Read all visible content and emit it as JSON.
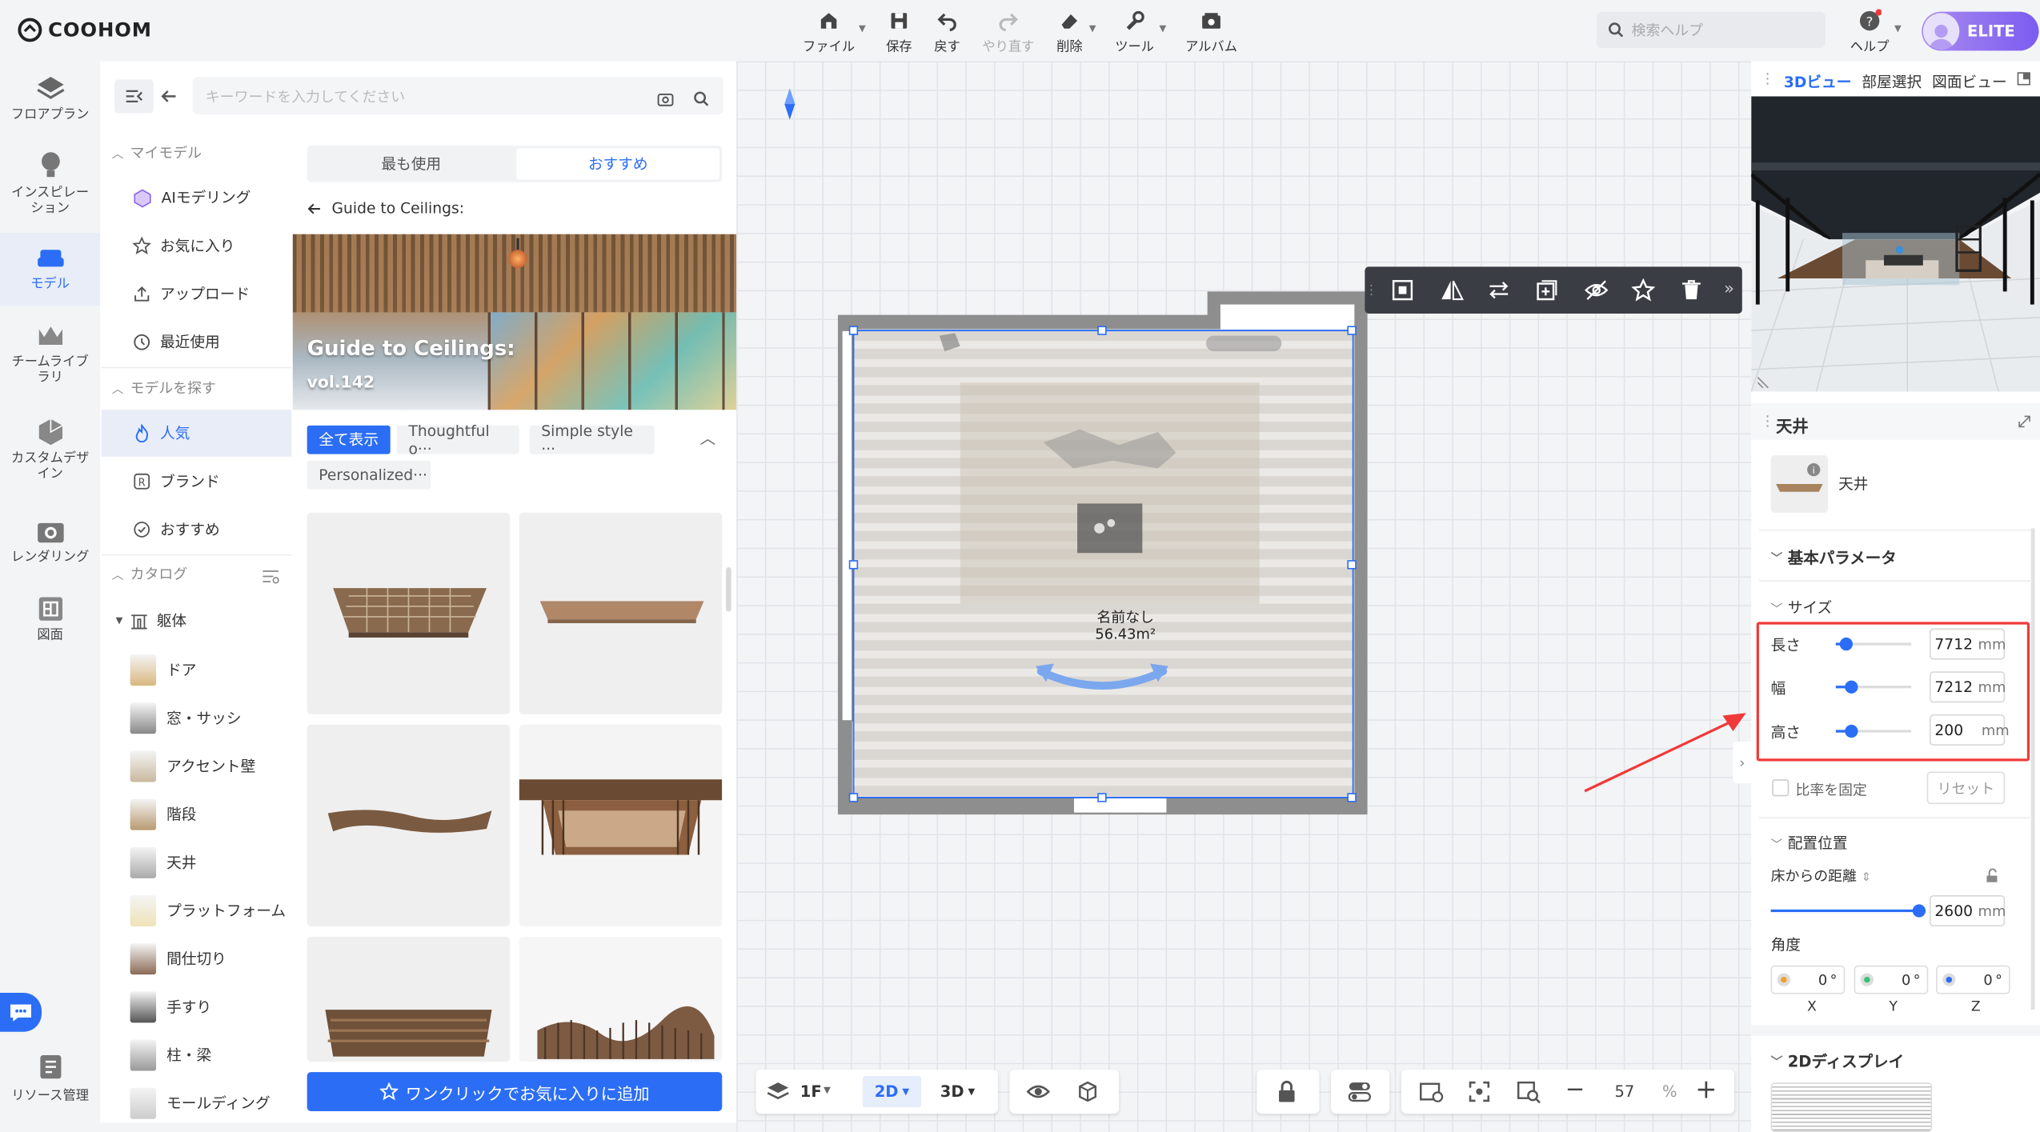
{
  "app": {
    "logo_text": "COOHOM"
  },
  "toolbar": {
    "items": [
      {
        "label": "ファイル",
        "icon": "home-file-icon"
      },
      {
        "label": "保存",
        "icon": "save-icon"
      },
      {
        "label": "戻す",
        "icon": "undo-icon"
      },
      {
        "label": "やり直す",
        "icon": "redo-icon"
      },
      {
        "label": "削除",
        "icon": "eraser-icon"
      },
      {
        "label": "ツール",
        "icon": "wrench-icon"
      },
      {
        "label": "アルバム",
        "icon": "album-icon"
      }
    ],
    "search_placeholder": "検索ヘルプ",
    "help_label": "ヘルプ",
    "elite_label": "ELITE"
  },
  "left_rail": [
    {
      "label": "フロアプラン"
    },
    {
      "label": "インスピレーション"
    },
    {
      "label": "モデル"
    },
    {
      "label": "チームライブラリ"
    },
    {
      "label": "カスタムデザイン"
    },
    {
      "label": "レンダリング"
    },
    {
      "label": "図面"
    },
    {
      "label": "リソース管理"
    }
  ],
  "catalog": {
    "search_placeholder": "キーワードを入力してください",
    "my_models_header": "マイモデル",
    "my_models": [
      "AIモデリング",
      "お気に入り",
      "アップロード",
      "最近使用"
    ],
    "explore_header": "モデルを探す",
    "explore": [
      "人気",
      "ブランド",
      "おすすめ"
    ],
    "catalog_header": "カタログ",
    "catalog_root": "躯体",
    "catalog_items": [
      "ドア",
      "窓・サッシ",
      "アクセント壁",
      "階段",
      "天井",
      "プラットフォーム",
      "間仕切り",
      "手すり",
      "柱・梁",
      "モールディング"
    ],
    "tabs": [
      "最も使用",
      "おすすめ"
    ],
    "guide_back": "Guide to Ceilings:",
    "banner_title": "Guide to Ceilings:",
    "banner_sub": "vol.142",
    "chips": [
      "全て表示",
      "Thoughtful o···",
      "Simple style ···",
      "Personalized···"
    ],
    "add_favorite": "ワンクリックでお気に入りに追加"
  },
  "canvas": {
    "room_name": "名前なし",
    "room_area": "56.43m²",
    "floor": "1F",
    "view_2d": "2D",
    "view_3d": "3D",
    "zoom": "57",
    "zoom_unit": "%"
  },
  "right_panel": {
    "tabs": [
      "3Dビュー",
      "部屋選択",
      "図面ビュー"
    ],
    "object_title": "天井",
    "object_name": "天井",
    "basic_params": "基本パラメータ",
    "size_header": "サイズ",
    "length_label": "長さ",
    "length_value": "7712",
    "length_unit": "mm",
    "width_label": "幅",
    "width_value": "7212",
    "width_unit": "mm",
    "height_label": "高さ",
    "height_value": "200",
    "height_unit": "mm",
    "lock_ratio": "比率を固定",
    "reset": "リセット",
    "placement_header": "配置位置",
    "floor_distance_label": "床からの距離",
    "floor_distance_value": "2600",
    "floor_distance_unit": "mm",
    "angle_label": "角度",
    "angle_x": "0",
    "angle_y": "0",
    "angle_z": "0",
    "angle_unit": "°",
    "axis_x": "X",
    "axis_y": "Y",
    "axis_z": "Z",
    "display_2d": "2Dディスプレイ"
  },
  "colors": {
    "accent": "#2b6ef5",
    "highlight": "#f03a3a",
    "elite": "#7b5cf0"
  }
}
